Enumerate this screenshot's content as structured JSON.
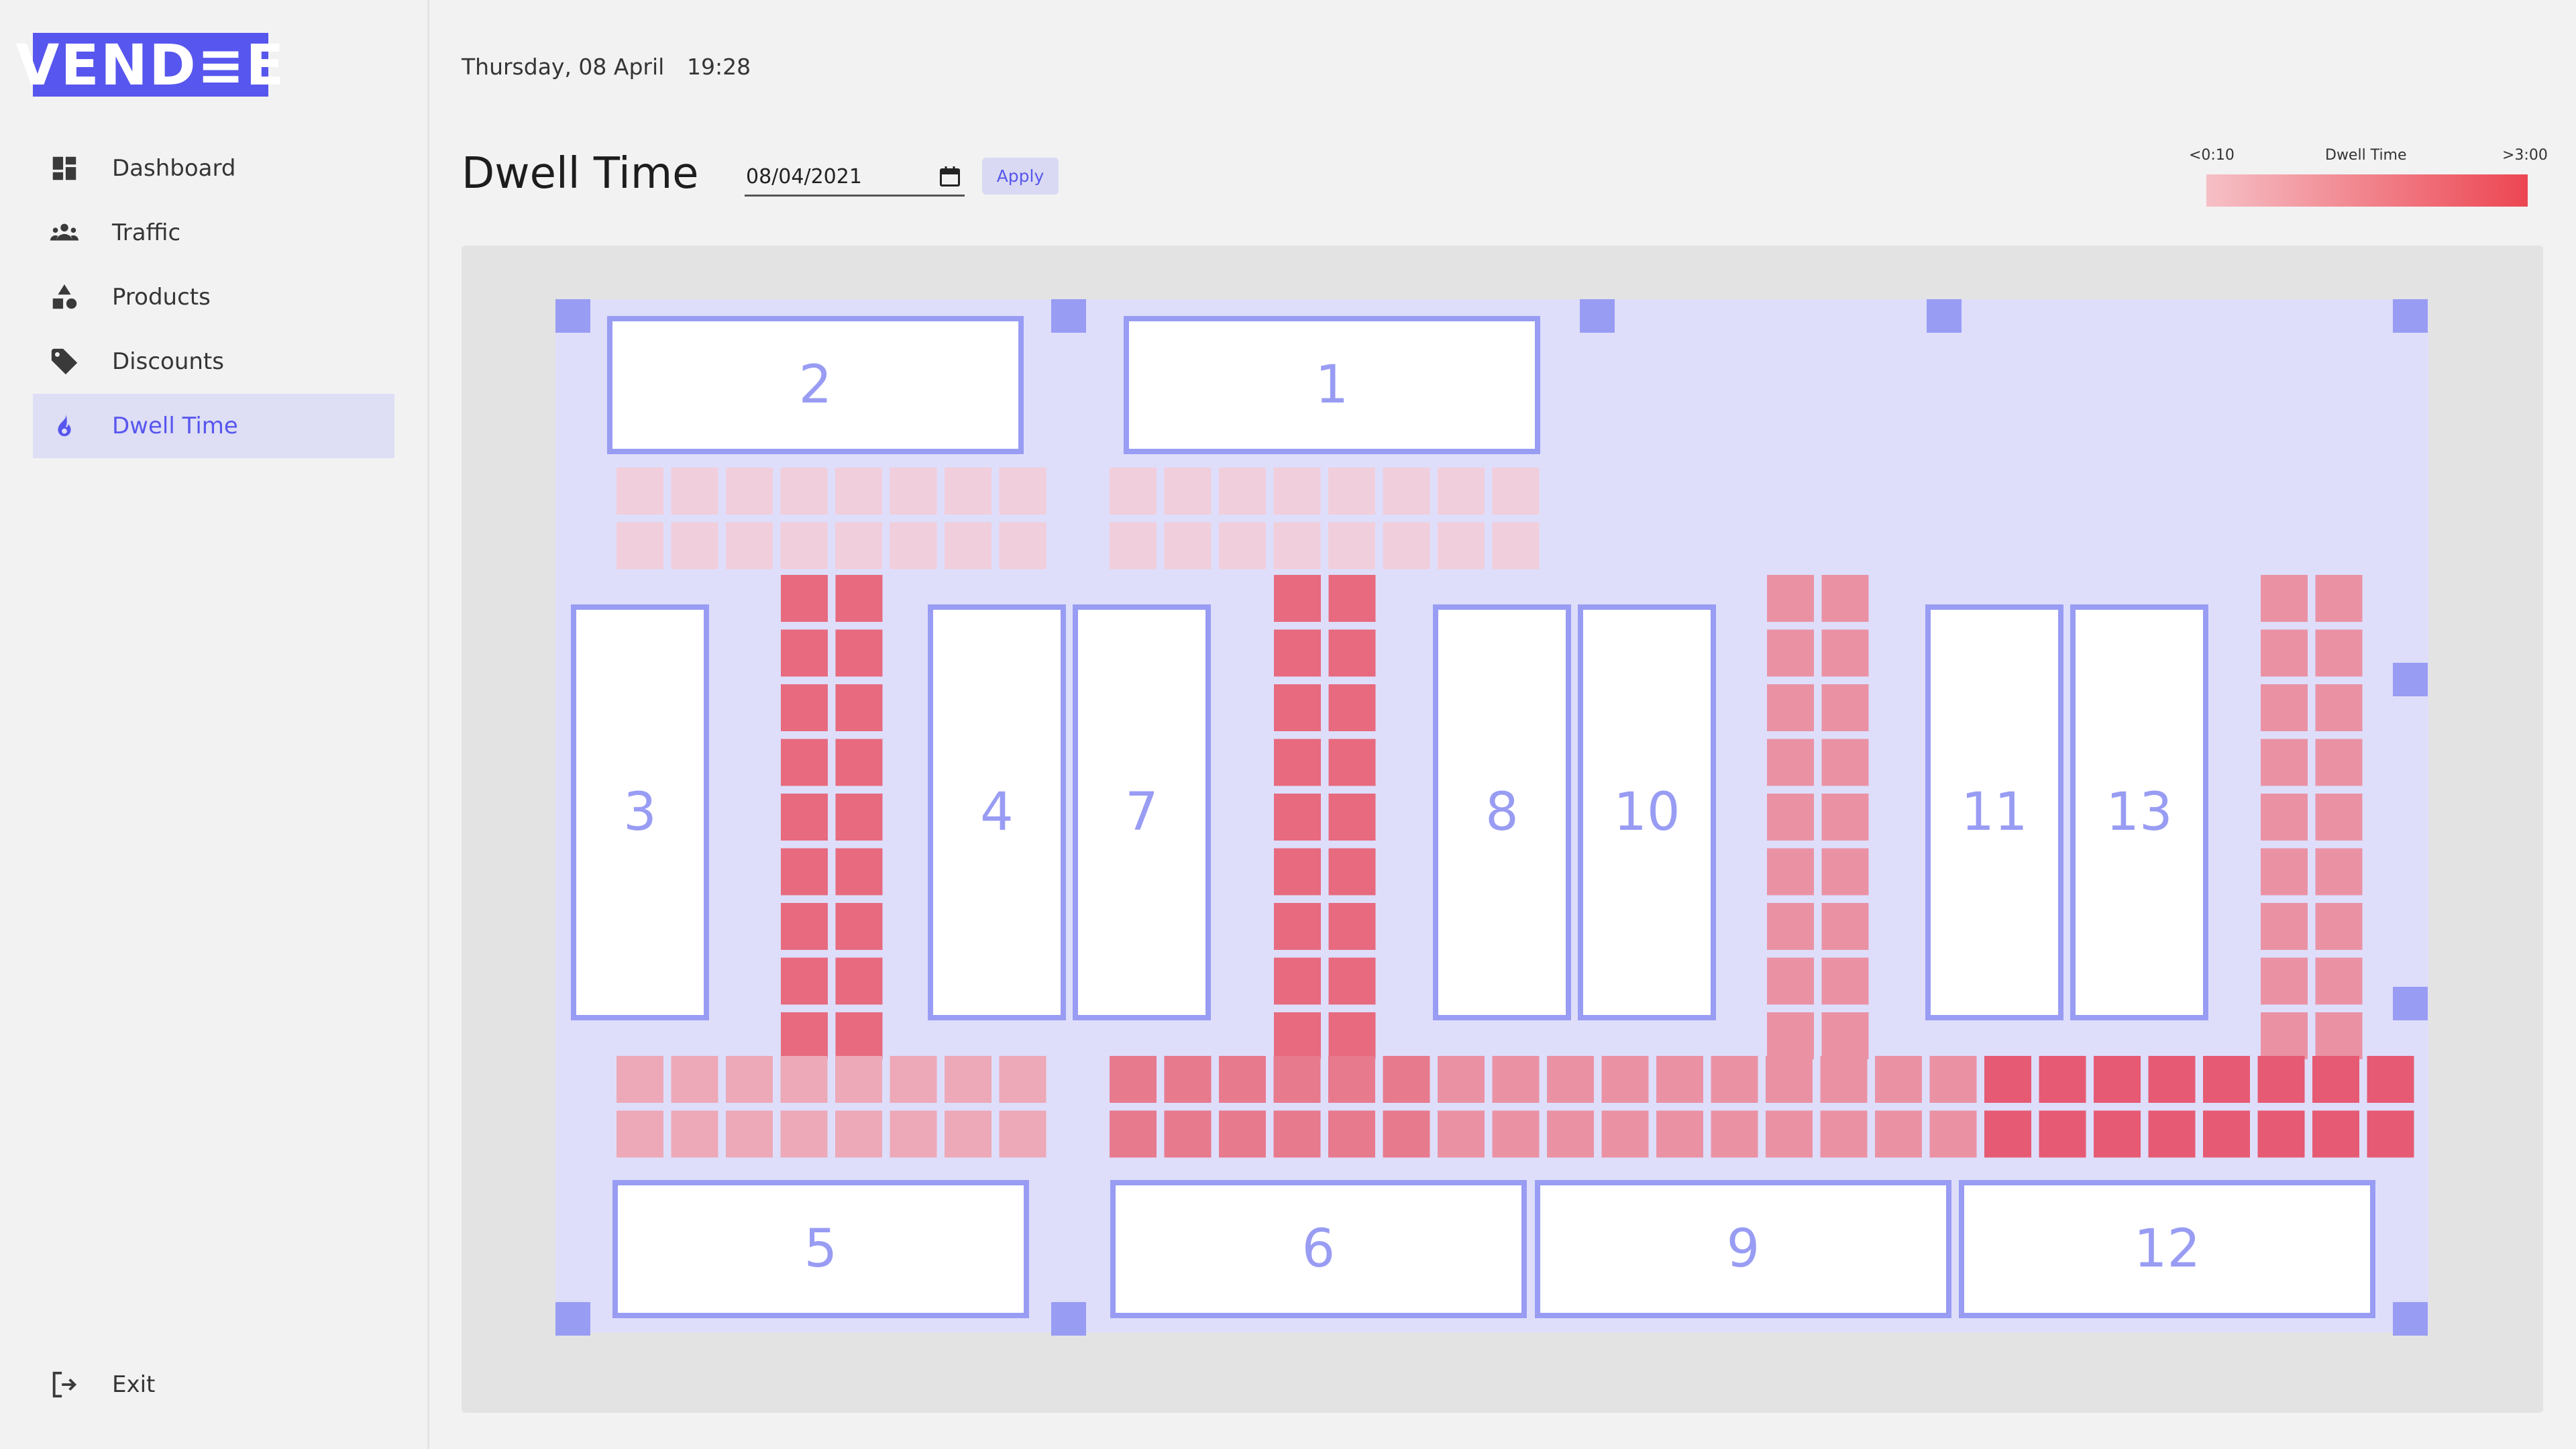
{
  "brand": {
    "logo_text": "VEND≡E",
    "accent_color": "#5756ee"
  },
  "nav": {
    "items": [
      {
        "label": "Dashboard",
        "icon": "dashboard-icon",
        "active": false
      },
      {
        "label": "Traffic",
        "icon": "people-icon",
        "active": false
      },
      {
        "label": "Products",
        "icon": "shapes-icon",
        "active": false
      },
      {
        "label": "Discounts",
        "icon": "tag-icon",
        "active": false
      },
      {
        "label": "Dwell Time",
        "icon": "flame-icon",
        "active": true
      }
    ],
    "exit_label": "Exit"
  },
  "header": {
    "date": "Thursday, 08 April",
    "time": "19:28"
  },
  "page": {
    "title": "Dwell Time"
  },
  "filter": {
    "date_value": "08/04/2021",
    "apply_label": "Apply"
  },
  "legend": {
    "title": "Dwell Time",
    "min_label": "<0:10",
    "max_label": ">3:00",
    "color_low": "#f6c0c6",
    "color_high": "#ec4652"
  },
  "store_map": {
    "shelves": [
      "2",
      "1",
      "3",
      "4",
      "7",
      "8",
      "10",
      "11",
      "13",
      "5",
      "6",
      "9",
      "12"
    ],
    "heat_colors": {
      "very_low": "#f1cedb",
      "low": "#eda9b8",
      "medium": "#ea92a4",
      "high": "#e87a8e",
      "very_high": "#e76a7e",
      "max": "#e65b73"
    },
    "zone_levels": {
      "top_left_aisle": "very_low",
      "top_mid_aisle": "very_low",
      "aisle_3_4": "very_high",
      "aisle_7_8": "very_high",
      "aisle_10_11": "medium",
      "aisle_13_right": "medium",
      "bottom_left_aisle": "low",
      "bottom_aisle_left_part": "high",
      "bottom_aisle_mid_part": "medium",
      "bottom_aisle_right_part": "max"
    }
  }
}
